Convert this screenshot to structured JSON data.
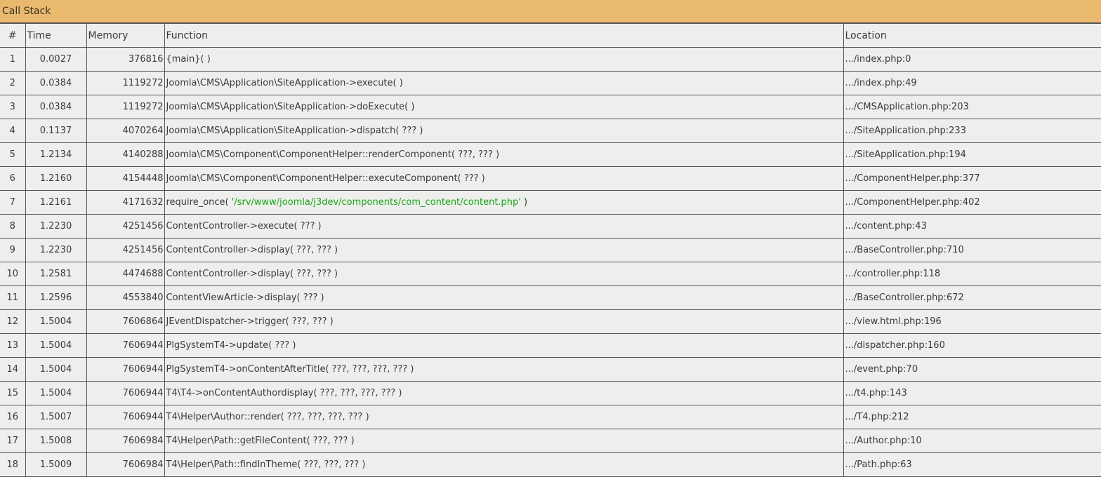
{
  "title": "Call Stack",
  "columns": [
    "#",
    "Time",
    "Memory",
    "Function",
    "Location"
  ],
  "colors": {
    "header_bar": "#e9b96e",
    "string_literal": "#18a818"
  },
  "rows": [
    {
      "n": "1",
      "time": "0.0027",
      "mem": "376816",
      "func": "{main}( )",
      "loc": ".../index.php:0"
    },
    {
      "n": "2",
      "time": "0.0384",
      "mem": "1119272",
      "func": "Joomla\\CMS\\Application\\SiteApplication->execute( )",
      "loc": ".../index.php:49"
    },
    {
      "n": "3",
      "time": "0.0384",
      "mem": "1119272",
      "func": "Joomla\\CMS\\Application\\SiteApplication->doExecute( )",
      "loc": ".../CMSApplication.php:203"
    },
    {
      "n": "4",
      "time": "0.1137",
      "mem": "4070264",
      "func": "Joomla\\CMS\\Application\\SiteApplication->dispatch( ??? )",
      "loc": ".../SiteApplication.php:233"
    },
    {
      "n": "5",
      "time": "1.2134",
      "mem": "4140288",
      "func": "Joomla\\CMS\\Component\\ComponentHelper::renderComponent( ???, ??? )",
      "loc": ".../SiteApplication.php:194"
    },
    {
      "n": "6",
      "time": "1.2160",
      "mem": "4154448",
      "func": "Joomla\\CMS\\Component\\ComponentHelper::executeComponent( ??? )",
      "loc": ".../ComponentHelper.php:377"
    },
    {
      "n": "7",
      "time": "1.2161",
      "mem": "4171632",
      "func": "require_once( ",
      "func_str": "'/srv/www/joomla/j3dev/components/com_content/content.php'",
      "func_end": " )",
      "loc": ".../ComponentHelper.php:402"
    },
    {
      "n": "8",
      "time": "1.2230",
      "mem": "4251456",
      "func": "ContentController->execute( ??? )",
      "loc": ".../content.php:43"
    },
    {
      "n": "9",
      "time": "1.2230",
      "mem": "4251456",
      "func": "ContentController->display( ???, ??? )",
      "loc": ".../BaseController.php:710"
    },
    {
      "n": "10",
      "time": "1.2581",
      "mem": "4474688",
      "func": "ContentController->display( ???, ??? )",
      "loc": ".../controller.php:118"
    },
    {
      "n": "11",
      "time": "1.2596",
      "mem": "4553840",
      "func": "ContentViewArticle->display( ??? )",
      "loc": ".../BaseController.php:672"
    },
    {
      "n": "12",
      "time": "1.5004",
      "mem": "7606864",
      "func": "JEventDispatcher->trigger( ???, ??? )",
      "loc": ".../view.html.php:196"
    },
    {
      "n": "13",
      "time": "1.5004",
      "mem": "7606944",
      "func": "PlgSystemT4->update( ??? )",
      "loc": ".../dispatcher.php:160"
    },
    {
      "n": "14",
      "time": "1.5004",
      "mem": "7606944",
      "func": "PlgSystemT4->onContentAfterTitle( ???, ???, ???, ??? )",
      "loc": ".../event.php:70"
    },
    {
      "n": "15",
      "time": "1.5004",
      "mem": "7606944",
      "func": "T4\\T4->onContentAuthordisplay( ???, ???, ???, ??? )",
      "loc": ".../t4.php:143"
    },
    {
      "n": "16",
      "time": "1.5007",
      "mem": "7606944",
      "func": "T4\\Helper\\Author::render( ???, ???, ???, ??? )",
      "loc": ".../T4.php:212"
    },
    {
      "n": "17",
      "time": "1.5008",
      "mem": "7606984",
      "func": "T4\\Helper\\Path::getFileContent( ???, ??? )",
      "loc": ".../Author.php:10"
    },
    {
      "n": "18",
      "time": "1.5009",
      "mem": "7606984",
      "func": "T4\\Helper\\Path::findInTheme( ???, ???, ??? )",
      "loc": ".../Path.php:63"
    }
  ]
}
